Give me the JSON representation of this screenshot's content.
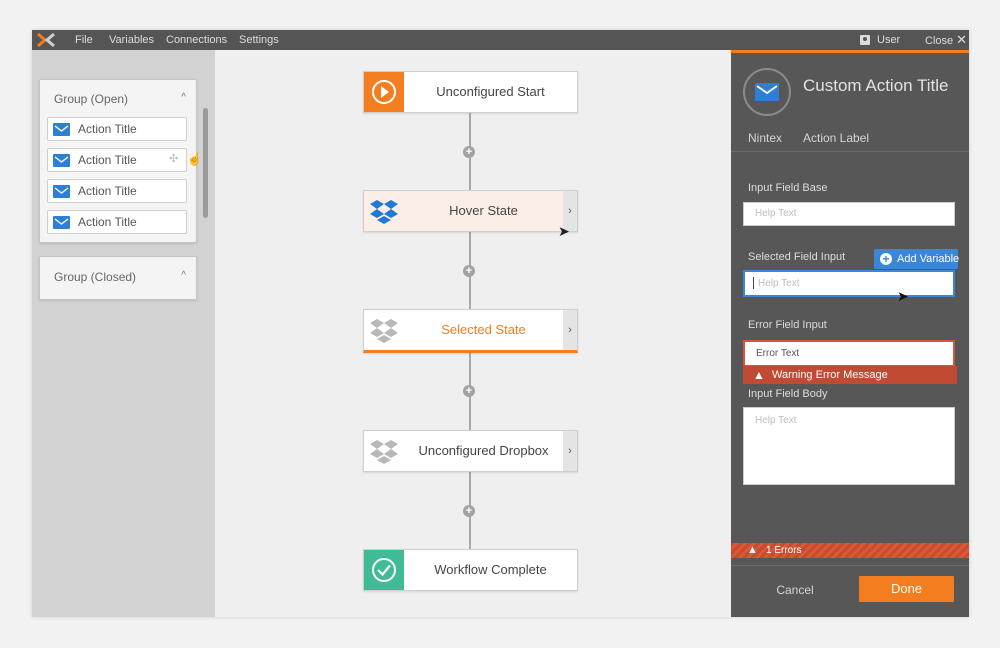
{
  "menu": {
    "items": [
      "File",
      "Variables",
      "Connections",
      "Settings"
    ],
    "user_label": "User",
    "close_label": "Close"
  },
  "sidebar": {
    "group_open": {
      "title": "Group (Open)",
      "items": [
        "Action Title",
        "Action Title",
        "Action Title",
        "Action Title"
      ]
    },
    "group_closed": {
      "title": "Group (Closed)"
    }
  },
  "workflow": {
    "nodes": [
      {
        "label": "Unconfigured Start",
        "icon": "play-icon",
        "color": "#f47d20"
      },
      {
        "label": "Hover State",
        "icon": "dropbox-icon",
        "color": "#1f78d6"
      },
      {
        "label": "Selected State",
        "icon": "dropbox-icon",
        "color": "#b8b8b8"
      },
      {
        "label": "Unconfigured Dropbox",
        "icon": "dropbox-icon",
        "color": "#b8b8b8"
      },
      {
        "label": "Workflow Complete",
        "icon": "check-icon",
        "color": "#3fbc96"
      }
    ]
  },
  "panel": {
    "title": "Custom Action Title",
    "subtitle_left": "Nintex",
    "subtitle_right": "Action Label",
    "fields": {
      "base": {
        "label": "Input Field Base",
        "placeholder": "Help Text"
      },
      "selected": {
        "label": "Selected Field Input",
        "placeholder": "Help Text",
        "add_variable": "Add Variable"
      },
      "error": {
        "label": "Error Field Input",
        "value": "Error Text",
        "message": "Warning Error Message"
      },
      "body": {
        "label": "Input Field Body",
        "placeholder": "Help Text"
      }
    },
    "errors_label": "1 Errors",
    "cancel_label": "Cancel",
    "done_label": "Done"
  },
  "colors": {
    "accent": "#f47d20",
    "blue": "#3a86d8",
    "error": "#c04a34",
    "success": "#3fbc96"
  }
}
